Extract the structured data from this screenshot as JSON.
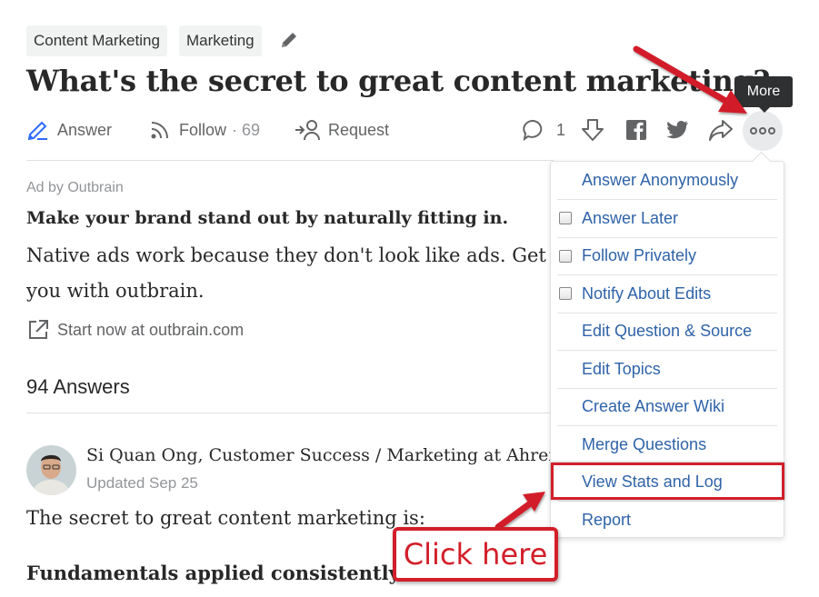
{
  "topics": [
    "Content Marketing",
    "Marketing"
  ],
  "question": {
    "title": "What's the secret to great content marketing?"
  },
  "actions": {
    "answer": "Answer",
    "follow": "Follow",
    "follow_count": "· 69",
    "request": "Request",
    "comment_count": "1"
  },
  "tooltip": "More",
  "ad": {
    "label": "Ad by Outbrain",
    "headline": "Make your brand stand out by naturally fitting in.",
    "body": "Native ads work because they don't look like ads. Get you with outbrain.",
    "link": "Start now at outbrain.com"
  },
  "answers": {
    "count_label": "94 Answers",
    "first": {
      "author": "Si Quan Ong, Customer Success / Marketing at Ahrefs",
      "updated": "Updated Sep 25",
      "text": "The secret to great content marketing is:",
      "bold": "Fundamentals applied consistently a"
    }
  },
  "menu": {
    "items": [
      {
        "label": "Answer Anonymously",
        "checkbox": false
      },
      {
        "label": "Answer Later",
        "checkbox": true
      },
      {
        "label": "Follow Privately",
        "checkbox": true
      },
      {
        "label": "Notify About Edits",
        "checkbox": true
      },
      {
        "label": "Edit Question & Source",
        "checkbox": false
      },
      {
        "label": "Edit Topics",
        "checkbox": false
      },
      {
        "label": "Create Answer Wiki",
        "checkbox": false
      },
      {
        "label": "Merge Questions",
        "checkbox": false
      },
      {
        "label": "View Stats and Log",
        "checkbox": false,
        "highlighted": true
      },
      {
        "label": "Report",
        "checkbox": false
      }
    ]
  },
  "annotation": {
    "callout": "Click here",
    "color": "#d21f2a"
  },
  "icons": [
    "pencil-icon",
    "answer-icon",
    "follow-icon",
    "request-icon",
    "comment-icon",
    "downvote-icon",
    "facebook-icon",
    "twitter-icon",
    "share-icon",
    "more-icon",
    "external-link-icon"
  ]
}
